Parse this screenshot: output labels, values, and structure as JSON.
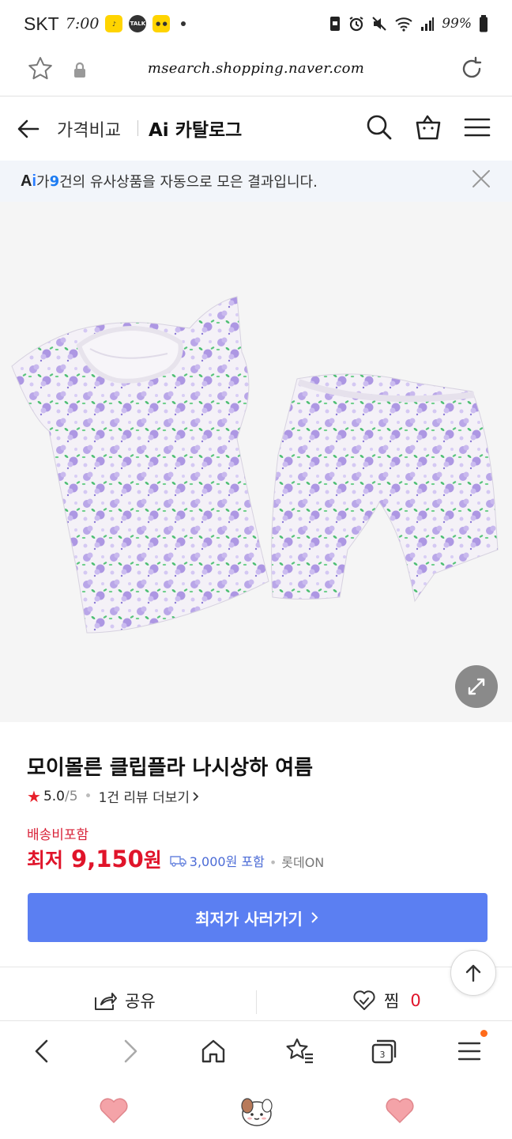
{
  "status_bar": {
    "carrier": "SKT",
    "time": "7:00",
    "battery": "99%"
  },
  "browser": {
    "url": "msearch.shopping.naver.com"
  },
  "header": {
    "crumb_price_compare": "가격비교",
    "crumb_ai_catalog": "Ai 카탈로그"
  },
  "notice": {
    "ai_label_a": "A",
    "ai_label_i": "i",
    "text_before": "가 ",
    "count": "9",
    "text_after": "건의 유사상품을 자동으로 모은 결과입니다."
  },
  "product": {
    "title": "모이몰른 클립플라 나시상하 여름",
    "rating": "5.0",
    "rating_max": "/5",
    "review_link": "1건 리뷰 더보기",
    "shipping_note": "배송비포함",
    "price_label": "최저",
    "price_value": "9,150",
    "price_unit": "원",
    "shipping_fee": "3,000원 포함",
    "seller": "롯데ON",
    "buy_button": "최저가 사러가기"
  },
  "actions": {
    "share_label": "공유",
    "like_label": "찜",
    "like_count": "0"
  },
  "browser_nav": {
    "tab_count": "3"
  },
  "colors": {
    "accent_blue": "#5b7ff2",
    "price_red": "#e0142a",
    "notice_bg": "#f2f5fa"
  }
}
